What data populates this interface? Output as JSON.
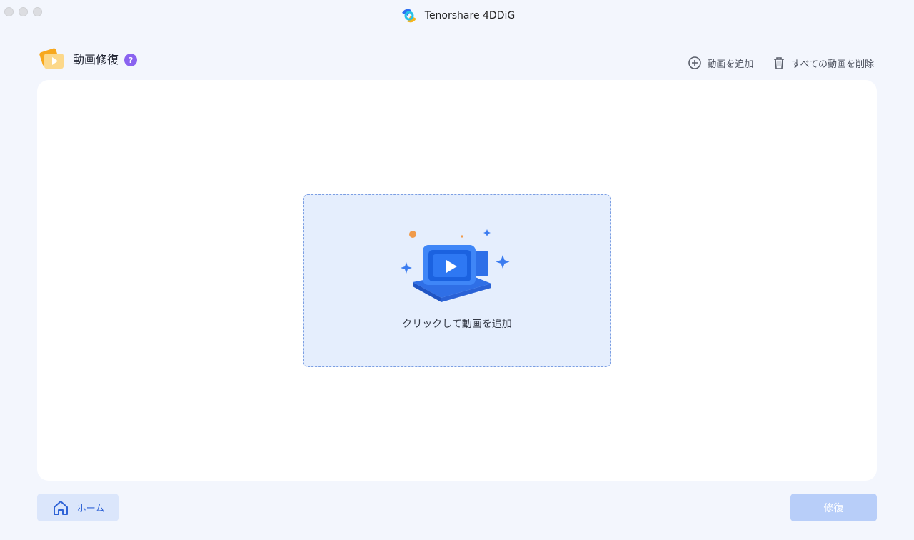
{
  "window": {
    "app_title": "Tenorshare 4DDiG"
  },
  "header": {
    "title": "動画修復",
    "help_label": "?"
  },
  "toolbar": {
    "add_video_label": "動画を追加",
    "delete_all_label": "すべての動画を削除"
  },
  "dropzone": {
    "hint": "クリックして動画を追加"
  },
  "footer": {
    "home_label": "ホーム",
    "repair_label": "修復"
  },
  "colors": {
    "accent": "#2f63d6",
    "repair_disabled": "#b8cef9",
    "help": "#8a63f0",
    "dropzone_bg": "#e5eefd"
  },
  "icons": [
    "app-logo-icon",
    "video-repair-icon",
    "help-icon",
    "add-circle-icon",
    "trash-icon",
    "video-upload-illustration",
    "home-icon"
  ]
}
